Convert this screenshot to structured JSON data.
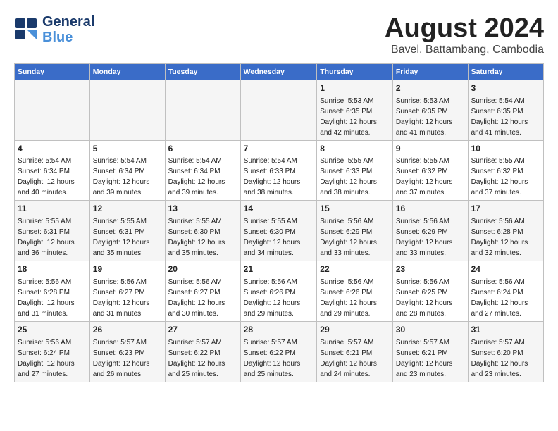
{
  "header": {
    "logo_line1": "General",
    "logo_line2": "Blue",
    "month": "August 2024",
    "location": "Bavel, Battambang, Cambodia"
  },
  "days_of_week": [
    "Sunday",
    "Monday",
    "Tuesday",
    "Wednesday",
    "Thursday",
    "Friday",
    "Saturday"
  ],
  "weeks": [
    [
      {
        "day": "",
        "info": ""
      },
      {
        "day": "",
        "info": ""
      },
      {
        "day": "",
        "info": ""
      },
      {
        "day": "",
        "info": ""
      },
      {
        "day": "1",
        "info": "Sunrise: 5:53 AM\nSunset: 6:35 PM\nDaylight: 12 hours\nand 42 minutes."
      },
      {
        "day": "2",
        "info": "Sunrise: 5:53 AM\nSunset: 6:35 PM\nDaylight: 12 hours\nand 41 minutes."
      },
      {
        "day": "3",
        "info": "Sunrise: 5:54 AM\nSunset: 6:35 PM\nDaylight: 12 hours\nand 41 minutes."
      }
    ],
    [
      {
        "day": "4",
        "info": "Sunrise: 5:54 AM\nSunset: 6:34 PM\nDaylight: 12 hours\nand 40 minutes."
      },
      {
        "day": "5",
        "info": "Sunrise: 5:54 AM\nSunset: 6:34 PM\nDaylight: 12 hours\nand 39 minutes."
      },
      {
        "day": "6",
        "info": "Sunrise: 5:54 AM\nSunset: 6:34 PM\nDaylight: 12 hours\nand 39 minutes."
      },
      {
        "day": "7",
        "info": "Sunrise: 5:54 AM\nSunset: 6:33 PM\nDaylight: 12 hours\nand 38 minutes."
      },
      {
        "day": "8",
        "info": "Sunrise: 5:55 AM\nSunset: 6:33 PM\nDaylight: 12 hours\nand 38 minutes."
      },
      {
        "day": "9",
        "info": "Sunrise: 5:55 AM\nSunset: 6:32 PM\nDaylight: 12 hours\nand 37 minutes."
      },
      {
        "day": "10",
        "info": "Sunrise: 5:55 AM\nSunset: 6:32 PM\nDaylight: 12 hours\nand 37 minutes."
      }
    ],
    [
      {
        "day": "11",
        "info": "Sunrise: 5:55 AM\nSunset: 6:31 PM\nDaylight: 12 hours\nand 36 minutes."
      },
      {
        "day": "12",
        "info": "Sunrise: 5:55 AM\nSunset: 6:31 PM\nDaylight: 12 hours\nand 35 minutes."
      },
      {
        "day": "13",
        "info": "Sunrise: 5:55 AM\nSunset: 6:30 PM\nDaylight: 12 hours\nand 35 minutes."
      },
      {
        "day": "14",
        "info": "Sunrise: 5:55 AM\nSunset: 6:30 PM\nDaylight: 12 hours\nand 34 minutes."
      },
      {
        "day": "15",
        "info": "Sunrise: 5:56 AM\nSunset: 6:29 PM\nDaylight: 12 hours\nand 33 minutes."
      },
      {
        "day": "16",
        "info": "Sunrise: 5:56 AM\nSunset: 6:29 PM\nDaylight: 12 hours\nand 33 minutes."
      },
      {
        "day": "17",
        "info": "Sunrise: 5:56 AM\nSunset: 6:28 PM\nDaylight: 12 hours\nand 32 minutes."
      }
    ],
    [
      {
        "day": "18",
        "info": "Sunrise: 5:56 AM\nSunset: 6:28 PM\nDaylight: 12 hours\nand 31 minutes."
      },
      {
        "day": "19",
        "info": "Sunrise: 5:56 AM\nSunset: 6:27 PM\nDaylight: 12 hours\nand 31 minutes."
      },
      {
        "day": "20",
        "info": "Sunrise: 5:56 AM\nSunset: 6:27 PM\nDaylight: 12 hours\nand 30 minutes."
      },
      {
        "day": "21",
        "info": "Sunrise: 5:56 AM\nSunset: 6:26 PM\nDaylight: 12 hours\nand 29 minutes."
      },
      {
        "day": "22",
        "info": "Sunrise: 5:56 AM\nSunset: 6:26 PM\nDaylight: 12 hours\nand 29 minutes."
      },
      {
        "day": "23",
        "info": "Sunrise: 5:56 AM\nSunset: 6:25 PM\nDaylight: 12 hours\nand 28 minutes."
      },
      {
        "day": "24",
        "info": "Sunrise: 5:56 AM\nSunset: 6:24 PM\nDaylight: 12 hours\nand 27 minutes."
      }
    ],
    [
      {
        "day": "25",
        "info": "Sunrise: 5:56 AM\nSunset: 6:24 PM\nDaylight: 12 hours\nand 27 minutes."
      },
      {
        "day": "26",
        "info": "Sunrise: 5:57 AM\nSunset: 6:23 PM\nDaylight: 12 hours\nand 26 minutes."
      },
      {
        "day": "27",
        "info": "Sunrise: 5:57 AM\nSunset: 6:22 PM\nDaylight: 12 hours\nand 25 minutes."
      },
      {
        "day": "28",
        "info": "Sunrise: 5:57 AM\nSunset: 6:22 PM\nDaylight: 12 hours\nand 25 minutes."
      },
      {
        "day": "29",
        "info": "Sunrise: 5:57 AM\nSunset: 6:21 PM\nDaylight: 12 hours\nand 24 minutes."
      },
      {
        "day": "30",
        "info": "Sunrise: 5:57 AM\nSunset: 6:21 PM\nDaylight: 12 hours\nand 23 minutes."
      },
      {
        "day": "31",
        "info": "Sunrise: 5:57 AM\nSunset: 6:20 PM\nDaylight: 12 hours\nand 23 minutes."
      }
    ]
  ]
}
